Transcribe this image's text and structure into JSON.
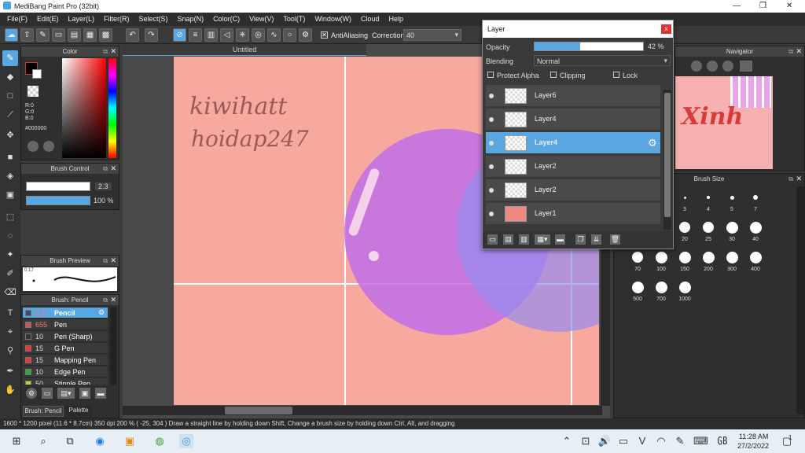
{
  "window": {
    "title": "MediBang Paint Pro (32bit)",
    "min": "—",
    "max": "❐",
    "close": "✕"
  },
  "menu": [
    "File(F)",
    "Edit(E)",
    "Layer(L)",
    "Filter(R)",
    "Select(S)",
    "Snap(N)",
    "Color(C)",
    "View(V)",
    "Tool(T)",
    "Window(W)",
    "Cloud",
    "Help"
  ],
  "toolbar": {
    "antialiasing_label": "AntiAliasing",
    "correction_label": "Correction",
    "correction_value": "40"
  },
  "canvas": {
    "tab_title": "Untitled",
    "handwriting_line1": "kiwihatt",
    "handwriting_line2": "hoidap247"
  },
  "color_panel": {
    "title": "Color",
    "r": "R:0",
    "g": "G:0",
    "b": "B:0",
    "hex": "#000000"
  },
  "brush_control": {
    "title": "Brush Control",
    "size": "2.3",
    "opacity": "100 %"
  },
  "brush_preview": {
    "title": "Brush Preview",
    "size": "0.17"
  },
  "brush_list": {
    "title": "Brush: Pencil",
    "items": [
      {
        "size": "2.3",
        "name": "Pencil"
      },
      {
        "size": "655",
        "name": "Pen"
      },
      {
        "size": "10",
        "name": "Pen (Sharp)"
      },
      {
        "size": "15",
        "name": "G Pen"
      },
      {
        "size": "15",
        "name": "Mapping Pen"
      },
      {
        "size": "10",
        "name": "Edge Pen"
      },
      {
        "size": "50",
        "name": "Stipple Pen"
      }
    ],
    "tab1": "Brush: Pencil",
    "tab2": "Palette"
  },
  "layer_window": {
    "title": "Layer",
    "opacity_label": "Opacity",
    "opacity_value": "42 %",
    "opacity": 0.42,
    "blending_label": "Blending",
    "blending_value": "Normal",
    "protect_alpha": "Protect Alpha",
    "clipping": "Clipping",
    "lock": "Lock",
    "layers": [
      "Layer6",
      "Layer4",
      "Layer4",
      "Layer2",
      "Layer2",
      "Layer1"
    ],
    "selected_index": 2
  },
  "navigator": {
    "title": "Navigator",
    "thumb_text": "Xinh"
  },
  "brush_size": {
    "title": "Brush Size",
    "sizes": [
      "3",
      "4",
      "5",
      "7",
      "20",
      "25",
      "30",
      "40",
      "70",
      "100",
      "150",
      "200",
      "300",
      "400",
      "500",
      "700",
      "1000"
    ]
  },
  "status": {
    "text": "1600 * 1200 pixel  (11.6 * 8.7cm)  350 dpi  200 %  ( -25, 304 )  Draw a straight line by holding down Shift, Change a brush size by holding down Ctrl, Alt, and dragging"
  },
  "taskbar": {
    "time": "11:28 AM",
    "date": "27/2/2022",
    "notif": "1"
  },
  "colors": {
    "canvas_bg": "#f7a99f",
    "accent": "#5aa6e0",
    "circle1": "#c97ae0",
    "circle2": "#a08be8"
  }
}
